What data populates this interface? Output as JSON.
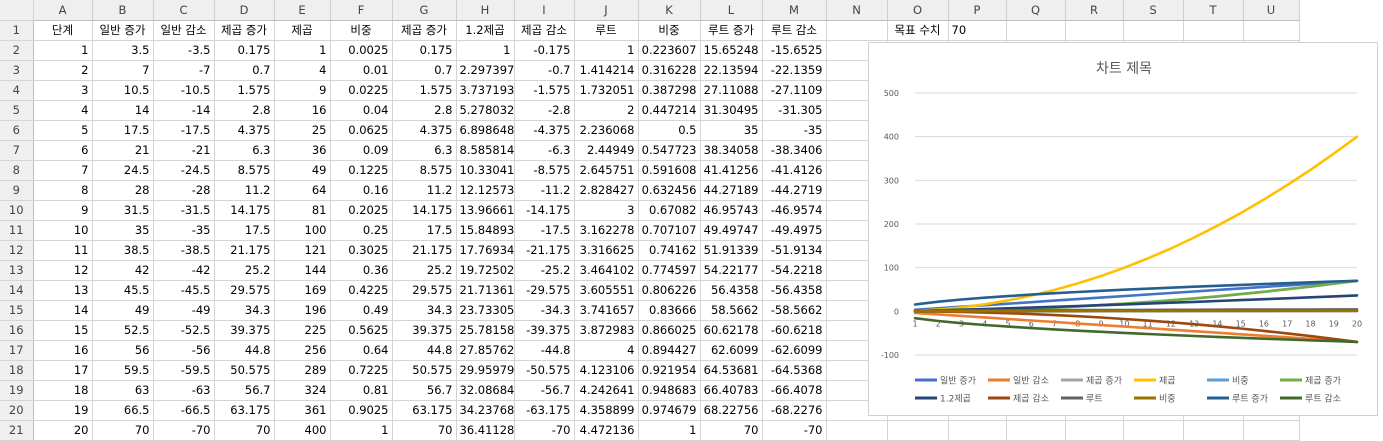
{
  "columns": [
    "A",
    "B",
    "C",
    "D",
    "E",
    "F",
    "G",
    "H",
    "I",
    "J",
    "K",
    "L",
    "M",
    "N",
    "O",
    "P",
    "Q",
    "R",
    "S",
    "T",
    "U",
    "V"
  ],
  "row_numbers": [
    "1",
    "2",
    "3",
    "4",
    "5",
    "6",
    "7",
    "8",
    "9",
    "10",
    "11",
    "12",
    "13",
    "14",
    "15",
    "16",
    "17",
    "18",
    "19",
    "20",
    "21"
  ],
  "headers": [
    "단계",
    "일반 증가",
    "일반 감소",
    "제곱 증가",
    "제곱",
    "비중",
    "제곱 증가",
    "1.2제곱",
    "제곱 감소",
    "루트",
    "비중",
    "루트 증가",
    "루트 감소"
  ],
  "target": {
    "label": "목표 수치",
    "value": "70"
  },
  "rows": [
    [
      "1",
      "3.5",
      "-3.5",
      "0.175",
      "1",
      "0.0025",
      "0.175",
      "1",
      "-0.175",
      "1",
      "0.223607",
      "15.65248",
      "-15.6525"
    ],
    [
      "2",
      "7",
      "-7",
      "0.7",
      "4",
      "0.01",
      "0.7",
      "2.297397",
      "-0.7",
      "1.414214",
      "0.316228",
      "22.13594",
      "-22.1359"
    ],
    [
      "3",
      "10.5",
      "-10.5",
      "1.575",
      "9",
      "0.0225",
      "1.575",
      "3.737193",
      "-1.575",
      "1.732051",
      "0.387298",
      "27.11088",
      "-27.1109"
    ],
    [
      "4",
      "14",
      "-14",
      "2.8",
      "16",
      "0.04",
      "2.8",
      "5.278032",
      "-2.8",
      "2",
      "0.447214",
      "31.30495",
      "-31.305"
    ],
    [
      "5",
      "17.5",
      "-17.5",
      "4.375",
      "25",
      "0.0625",
      "4.375",
      "6.898648",
      "-4.375",
      "2.236068",
      "0.5",
      "35",
      "-35"
    ],
    [
      "6",
      "21",
      "-21",
      "6.3",
      "36",
      "0.09",
      "6.3",
      "8.585814",
      "-6.3",
      "2.44949",
      "0.547723",
      "38.34058",
      "-38.3406"
    ],
    [
      "7",
      "24.5",
      "-24.5",
      "8.575",
      "49",
      "0.1225",
      "8.575",
      "10.33041",
      "-8.575",
      "2.645751",
      "0.591608",
      "41.41256",
      "-41.4126"
    ],
    [
      "8",
      "28",
      "-28",
      "11.2",
      "64",
      "0.16",
      "11.2",
      "12.12573",
      "-11.2",
      "2.828427",
      "0.632456",
      "44.27189",
      "-44.2719"
    ],
    [
      "9",
      "31.5",
      "-31.5",
      "14.175",
      "81",
      "0.2025",
      "14.175",
      "13.96661",
      "-14.175",
      "3",
      "0.67082",
      "46.95743",
      "-46.9574"
    ],
    [
      "10",
      "35",
      "-35",
      "17.5",
      "100",
      "0.25",
      "17.5",
      "15.84893",
      "-17.5",
      "3.162278",
      "0.707107",
      "49.49747",
      "-49.4975"
    ],
    [
      "11",
      "38.5",
      "-38.5",
      "21.175",
      "121",
      "0.3025",
      "21.175",
      "17.76934",
      "-21.175",
      "3.316625",
      "0.74162",
      "51.91339",
      "-51.9134"
    ],
    [
      "12",
      "42",
      "-42",
      "25.2",
      "144",
      "0.36",
      "25.2",
      "19.72502",
      "-25.2",
      "3.464102",
      "0.774597",
      "54.22177",
      "-54.2218"
    ],
    [
      "13",
      "45.5",
      "-45.5",
      "29.575",
      "169",
      "0.4225",
      "29.575",
      "21.71361",
      "-29.575",
      "3.605551",
      "0.806226",
      "56.4358",
      "-56.4358"
    ],
    [
      "14",
      "49",
      "-49",
      "34.3",
      "196",
      "0.49",
      "34.3",
      "23.73305",
      "-34.3",
      "3.741657",
      "0.83666",
      "58.5662",
      "-58.5662"
    ],
    [
      "15",
      "52.5",
      "-52.5",
      "39.375",
      "225",
      "0.5625",
      "39.375",
      "25.78158",
      "-39.375",
      "3.872983",
      "0.866025",
      "60.62178",
      "-60.6218"
    ],
    [
      "16",
      "56",
      "-56",
      "44.8",
      "256",
      "0.64",
      "44.8",
      "27.85762",
      "-44.8",
      "4",
      "0.894427",
      "62.6099",
      "-62.6099"
    ],
    [
      "17",
      "59.5",
      "-59.5",
      "50.575",
      "289",
      "0.7225",
      "50.575",
      "29.95979",
      "-50.575",
      "4.123106",
      "0.921954",
      "64.53681",
      "-64.5368"
    ],
    [
      "18",
      "63",
      "-63",
      "56.7",
      "324",
      "0.81",
      "56.7",
      "32.08684",
      "-56.7",
      "4.242641",
      "0.948683",
      "66.40783",
      "-66.4078"
    ],
    [
      "19",
      "66.5",
      "-66.5",
      "63.175",
      "361",
      "0.9025",
      "63.175",
      "34.23768",
      "-63.175",
      "4.358899",
      "0.974679",
      "68.22756",
      "-68.2276"
    ],
    [
      "20",
      "70",
      "-70",
      "70",
      "400",
      "1",
      "70",
      "36.41128",
      "-70",
      "4.472136",
      "1",
      "70",
      "-70"
    ]
  ],
  "chart_data": {
    "type": "line",
    "title": "차트 제목",
    "x": [
      "1",
      "2",
      "3",
      "4",
      "5",
      "6",
      "7",
      "8",
      "9",
      "10",
      "11",
      "12",
      "13",
      "14",
      "15",
      "16",
      "17",
      "18",
      "19",
      "20"
    ],
    "ylim": [
      -100,
      500
    ],
    "yticks": [
      "-100",
      "0",
      "100",
      "200",
      "300",
      "400",
      "500"
    ],
    "grid": true,
    "legend": "bottom",
    "series": [
      {
        "name": "일반 증가",
        "color": "#4472C4",
        "values": [
          3.5,
          7,
          10.5,
          14,
          17.5,
          21,
          24.5,
          28,
          31.5,
          35,
          38.5,
          42,
          45.5,
          49,
          52.5,
          56,
          59.5,
          63,
          66.5,
          70
        ]
      },
      {
        "name": "일반 감소",
        "color": "#ED7D31",
        "values": [
          -3.5,
          -7,
          -10.5,
          -14,
          -17.5,
          -21,
          -24.5,
          -28,
          -31.5,
          -35,
          -38.5,
          -42,
          -45.5,
          -49,
          -52.5,
          -56,
          -59.5,
          -63,
          -66.5,
          -70
        ]
      },
      {
        "name": "제곱 증가",
        "color": "#A5A5A5",
        "values": [
          0.175,
          0.7,
          1.575,
          2.8,
          4.375,
          6.3,
          8.575,
          11.2,
          14.175,
          17.5,
          21.175,
          25.2,
          29.575,
          34.3,
          39.375,
          44.8,
          50.575,
          56.7,
          63.175,
          70
        ]
      },
      {
        "name": "제곱",
        "color": "#FFC000",
        "values": [
          1,
          4,
          9,
          16,
          25,
          36,
          49,
          64,
          81,
          100,
          121,
          144,
          169,
          196,
          225,
          256,
          289,
          324,
          361,
          400
        ]
      },
      {
        "name": "비중",
        "color": "#5B9BD5",
        "values": [
          0.0025,
          0.01,
          0.0225,
          0.04,
          0.0625,
          0.09,
          0.1225,
          0.16,
          0.2025,
          0.25,
          0.3025,
          0.36,
          0.4225,
          0.49,
          0.5625,
          0.64,
          0.7225,
          0.81,
          0.9025,
          1
        ]
      },
      {
        "name": "제곱 증가",
        "color": "#70AD47",
        "values": [
          0.175,
          0.7,
          1.575,
          2.8,
          4.375,
          6.3,
          8.575,
          11.2,
          14.175,
          17.5,
          21.175,
          25.2,
          29.575,
          34.3,
          39.375,
          44.8,
          50.575,
          56.7,
          63.175,
          70
        ]
      },
      {
        "name": "1.2제곱",
        "color": "#264478",
        "values": [
          1,
          2.297397,
          3.737193,
          5.278032,
          6.898648,
          8.585814,
          10.33041,
          12.12573,
          13.96661,
          15.84893,
          17.76934,
          19.72502,
          21.71361,
          23.73305,
          25.78158,
          27.85762,
          29.95979,
          32.08684,
          34.23768,
          36.41128
        ]
      },
      {
        "name": "제곱 감소",
        "color": "#9E480E",
        "values": [
          -0.175,
          -0.7,
          -1.575,
          -2.8,
          -4.375,
          -6.3,
          -8.575,
          -11.2,
          -14.175,
          -17.5,
          -21.175,
          -25.2,
          -29.575,
          -34.3,
          -39.375,
          -44.8,
          -50.575,
          -56.7,
          -63.175,
          -70
        ]
      },
      {
        "name": "루트",
        "color": "#636363",
        "values": [
          1,
          1.414214,
          1.732051,
          2,
          2.236068,
          2.44949,
          2.645751,
          2.828427,
          3,
          3.162278,
          3.316625,
          3.464102,
          3.605551,
          3.741657,
          3.872983,
          4,
          4.123106,
          4.242641,
          4.358899,
          4.472136
        ]
      },
      {
        "name": "비중",
        "color": "#997300",
        "values": [
          0.223607,
          0.316228,
          0.387298,
          0.447214,
          0.5,
          0.547723,
          0.591608,
          0.632456,
          0.67082,
          0.707107,
          0.74162,
          0.774597,
          0.806226,
          0.83666,
          0.866025,
          0.894427,
          0.921954,
          0.948683,
          0.974679,
          1
        ]
      },
      {
        "name": "루트 증가",
        "color": "#255E91",
        "values": [
          15.65248,
          22.13594,
          27.11088,
          31.30495,
          35,
          38.34058,
          41.41256,
          44.27189,
          46.95743,
          49.49747,
          51.91339,
          54.22177,
          56.4358,
          58.5662,
          60.62178,
          62.6099,
          64.53681,
          66.40783,
          68.22756,
          70
        ]
      },
      {
        "name": "루트 감소",
        "color": "#43682B",
        "values": [
          -15.6525,
          -22.1359,
          -27.1109,
          -31.305,
          -35,
          -38.3406,
          -41.4126,
          -44.2719,
          -46.9574,
          -49.4975,
          -51.9134,
          -54.2218,
          -56.4358,
          -58.5662,
          -60.6218,
          -62.6099,
          -64.5368,
          -66.4078,
          -68.2276,
          -70
        ]
      }
    ]
  }
}
